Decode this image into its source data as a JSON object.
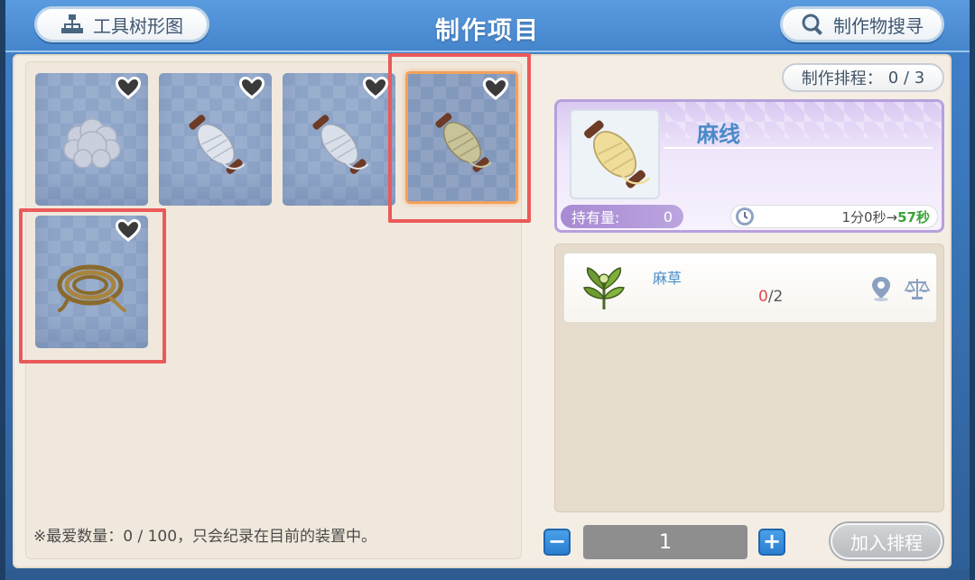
{
  "header": {
    "title": "制作项目",
    "tree_button_label": "工具树形图",
    "search_button_label": "制作物搜寻"
  },
  "schedule": {
    "label": "制作排程：",
    "value": "0 / 3"
  },
  "slots": [
    {
      "item": "cotton",
      "favorite": false,
      "selected": false
    },
    {
      "item": "thread-white",
      "favorite": false,
      "selected": false
    },
    {
      "item": "thread-white",
      "favorite": false,
      "selected": false
    },
    {
      "item": "hemp-thread",
      "favorite": false,
      "selected": true
    },
    {
      "item": "rope",
      "favorite": false,
      "selected": false
    }
  ],
  "favorites_note": "※最爱数量：0 / 100，只会纪录在目前的装置中。",
  "detail": {
    "name": "麻线",
    "owned_label": "持有量:",
    "owned_value": "0",
    "time_text": "1分0秒→",
    "time_fast": "57秒"
  },
  "materials": [
    {
      "name": "麻草",
      "have": "0",
      "need": "/2"
    }
  ],
  "quantity": {
    "minus_label": "−",
    "value": "1",
    "plus_label": "+"
  },
  "add_button_label": "加入排程",
  "colors": {
    "accent_blue": "#4a8bc7",
    "highlight_orange": "#f2a15b",
    "annotation_red": "#ea5a5a",
    "time_green": "#3aa33a"
  }
}
